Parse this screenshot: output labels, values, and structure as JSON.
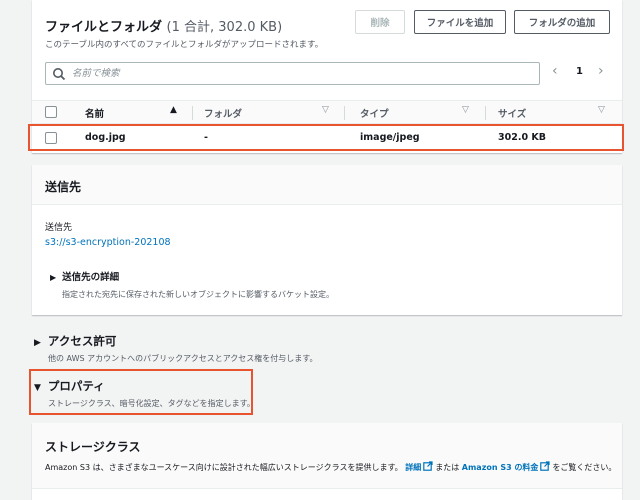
{
  "files": {
    "title": "ファイルとフォルダ",
    "count_text": "(1 合計, 302.0 KB)",
    "description": "このテーブル内のすべてのファイルとフォルダがアップロードされます。",
    "delete_label": "削除",
    "add_files_label": "ファイルを追加",
    "add_folder_label": "フォルダの追加",
    "search_placeholder": "名前で検索",
    "page_current": "1",
    "prev_icon": "‹",
    "next_icon": "›",
    "columns": [
      "名前",
      "フォルダ",
      "タイプ",
      "サイズ"
    ],
    "rows": [
      {
        "name": "dog.jpg",
        "folder": "-",
        "type": "image/jpeg",
        "size": "302.0 KB"
      }
    ]
  },
  "destination": {
    "title": "送信先",
    "label": "送信先",
    "link": "s3://s3-encryption-202108",
    "details_title": "送信先の詳細",
    "details_desc": "指定された宛先に保存された新しいオブジェクトに影響するバケット設定。"
  },
  "access": {
    "title": "アクセス許可",
    "desc": "他の AWS アカウントへのパブリックアクセスとアクセス権を付与します。"
  },
  "properties": {
    "title": "プロパティ",
    "desc": "ストレージクラス、暗号化設定、タグなどを指定します。"
  },
  "storage_class": {
    "title": "ストレージクラス",
    "desc_1": "Amazon S3 は、さまざまなユースケース向けに設計された幅広いストレージクラスを提供します。",
    "link_details": "詳細",
    "desc_2": "または",
    "link_pricing": "Amazon S3 の料金",
    "desc_3": "をご覧ください。"
  },
  "icons": {
    "expand_collapsed": "▶",
    "expand_open": "▼",
    "sort_asc": "▲",
    "sort_none": "▽"
  },
  "colors": {
    "highlight": "#e8542f",
    "link": "#0073bb",
    "background": "#f2f3f3"
  }
}
